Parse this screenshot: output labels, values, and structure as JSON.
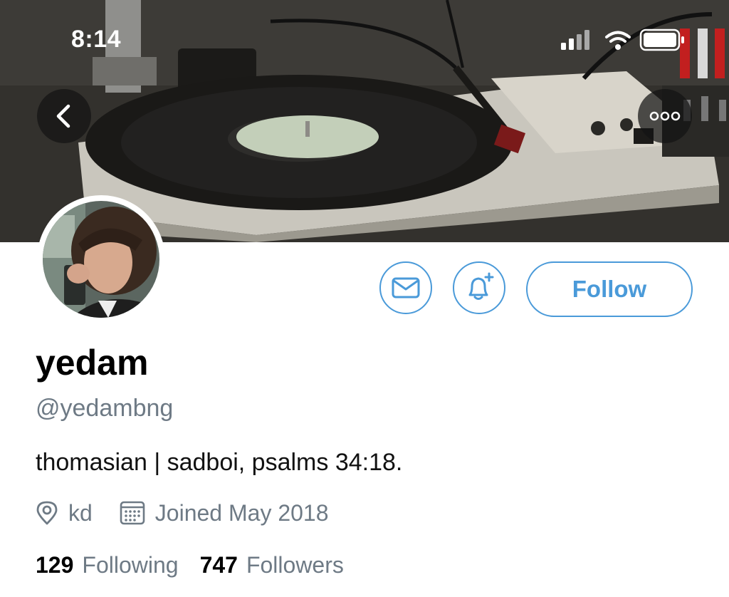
{
  "status_bar": {
    "time": "8:14",
    "icons": [
      "cellular-signal-icon",
      "wifi-icon",
      "battery-icon"
    ]
  },
  "header": {
    "back_icon": "chevron-left-icon",
    "more_icon": "ellipsis-icon"
  },
  "actions": {
    "message_icon": "envelope-icon",
    "notify_icon": "bell-plus-icon",
    "follow_label": "Follow"
  },
  "profile": {
    "display_name": "yedam",
    "handle": "@yedambng",
    "bio": "thomasian | sadboi, psalms 34:18.",
    "location": "kd",
    "joined": "Joined May 2018"
  },
  "stats": {
    "following_count": "129",
    "following_label": "Following",
    "followers_count": "747",
    "followers_label": "Followers"
  },
  "colors": {
    "accent": "#4a9ad9",
    "secondary_text": "#6e7a85",
    "primary_text": "#000000"
  }
}
